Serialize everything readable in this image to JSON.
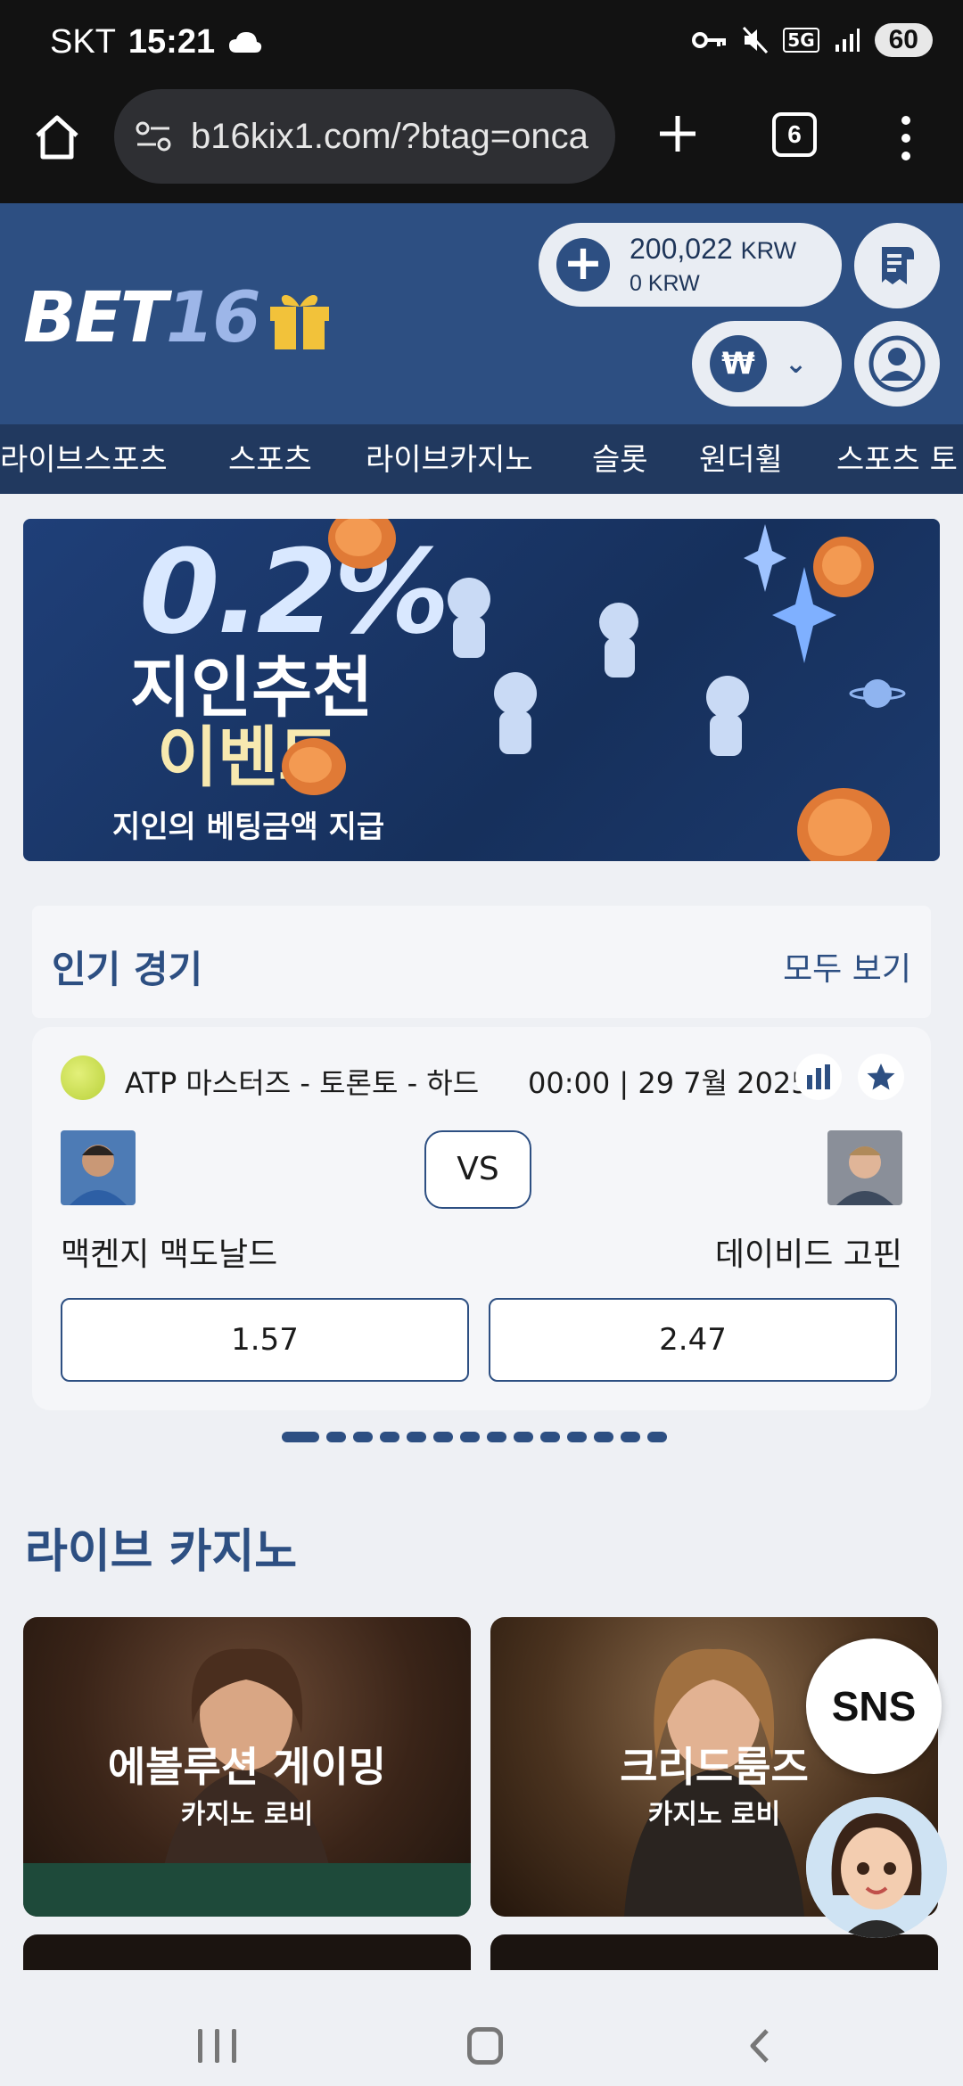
{
  "status_bar": {
    "carrier": "SKT",
    "time": "15:21",
    "network": "5G",
    "battery": "60"
  },
  "browser": {
    "url": "b16kix1.com/?btag=onca",
    "tab_count": "6"
  },
  "header": {
    "logo_text": "BET",
    "logo_number": "16",
    "balance": "200,022",
    "balance_currency": "KRW",
    "bonus_balance": "0 KRW",
    "currency_symbol": "₩"
  },
  "nav": {
    "items": [
      "라이브스포츠",
      "스포츠",
      "라이브카지노",
      "슬롯",
      "원더휠",
      "스포츠 토"
    ]
  },
  "banner": {
    "percent": "0.2%",
    "line1": "지인추천",
    "line2": "이벤트",
    "subtitle": "지인의 베팅금액 지급"
  },
  "popular": {
    "title": "인기 경기",
    "view_all": "모두 보기",
    "match": {
      "league": "ATP 마스터즈 - 토론토 - 하드",
      "datetime": "00:00 | 29 7월 2025",
      "vs": "VS",
      "home_player": "맥켄지 맥도날드",
      "away_player": "데이비드 고핀",
      "home_odds": "1.57",
      "away_odds": "2.47"
    },
    "carousel_pages": 14,
    "carousel_active_index": 0
  },
  "live_casino": {
    "title": "라이브 카지노",
    "tiles": [
      {
        "title": "에볼루션 게이밍",
        "subtitle": "카지노 로비"
      },
      {
        "title": "크리드룸즈",
        "subtitle": "카지노 로비"
      }
    ]
  },
  "floating": {
    "sns_label": "SNS"
  },
  "colors": {
    "brand_blue": "#2d4f82",
    "nav_dark": "#21395f",
    "gift_gold": "#f2c23a"
  }
}
